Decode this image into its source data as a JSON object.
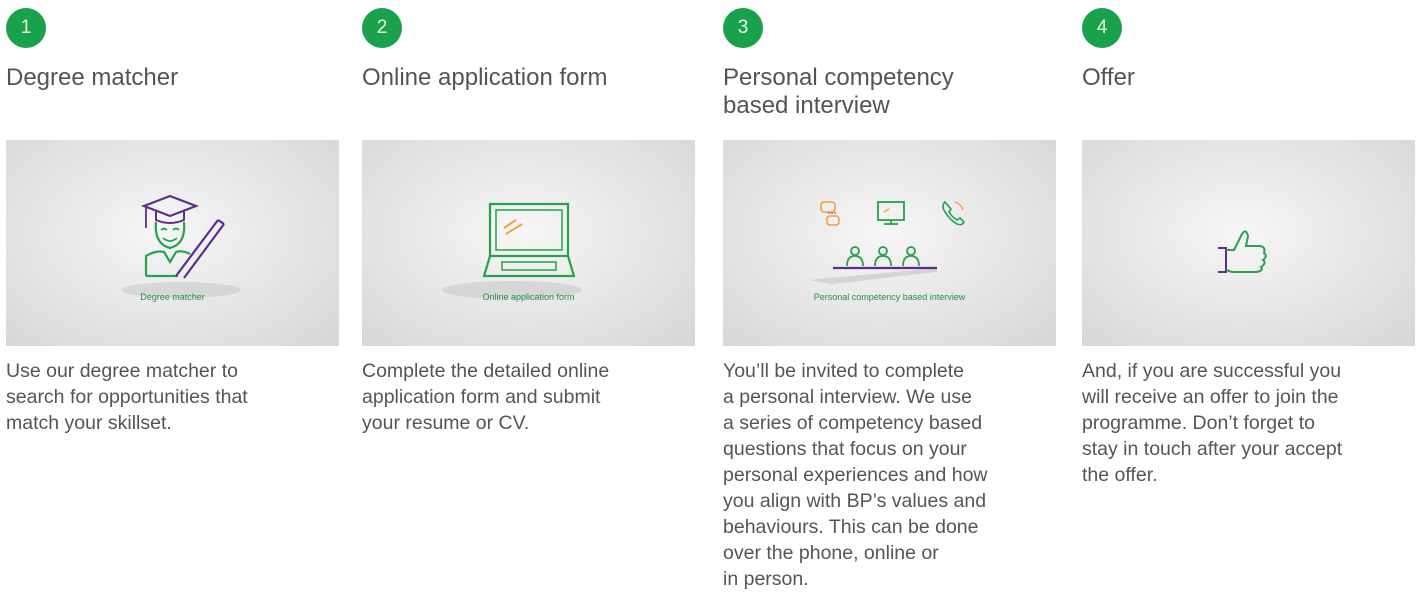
{
  "steps": [
    {
      "number": "1",
      "title": "Degree matcher",
      "image_caption": "Degree matcher",
      "icon": "graduate-icon",
      "description": "Use our degree matcher to\nsearch for opportunities that\nmatch your skillset."
    },
    {
      "number": "2",
      "title": "Online application form",
      "image_caption": "Online application form",
      "icon": "laptop-icon",
      "description": "Complete the detailed online\napplication form and submit\nyour resume or CV."
    },
    {
      "number": "3",
      "title": "Personal competency\nbased interview",
      "image_caption": "Personal competency based  interview",
      "icon": "interview-panel-icon",
      "description": "You’ll be invited to complete\na personal interview. We use\na series of competency based\nquestions that focus on your\npersonal experiences and how\nyou align with BP’s values and\nbehaviours. This can be done\nover the phone, online or\nin person."
    },
    {
      "number": "4",
      "title": "Offer",
      "image_caption": "",
      "icon": "thumbs-up-icon",
      "description": "And, if you are successful you\nwill receive an offer to join the\nprogramme. Don’t forget to\nstay in touch after your accept\nthe offer."
    }
  ],
  "colors": {
    "badge": "#1aa14b",
    "icon_green": "#25a24a",
    "icon_purple": "#5b2d8e",
    "icon_orange": "#f2a03d",
    "text": "#555555"
  }
}
